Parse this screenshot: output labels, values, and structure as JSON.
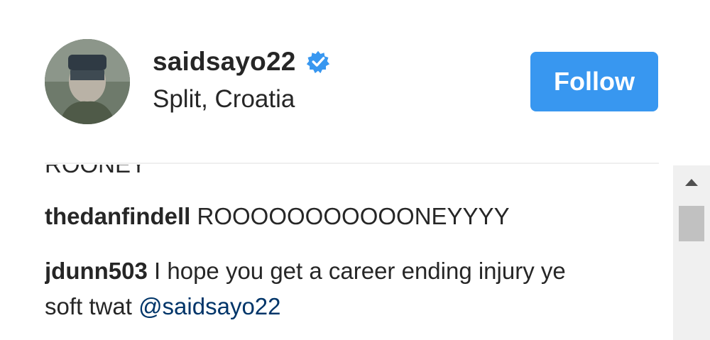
{
  "post_header": {
    "username": "saidsayo22",
    "location": "Split, Croatia",
    "follow_label": "Follow",
    "accent_color": "#3897f0"
  },
  "comments": {
    "partial_top_text": "ROONEY",
    "items": [
      {
        "user": "thedanfindell",
        "text": " ROOOOOOOOOOONEYYYY"
      },
      {
        "user": "jdunn503",
        "text": " I hope you get a career ending injury ye soft twat ",
        "mention": "@saidsayo22"
      }
    ]
  }
}
